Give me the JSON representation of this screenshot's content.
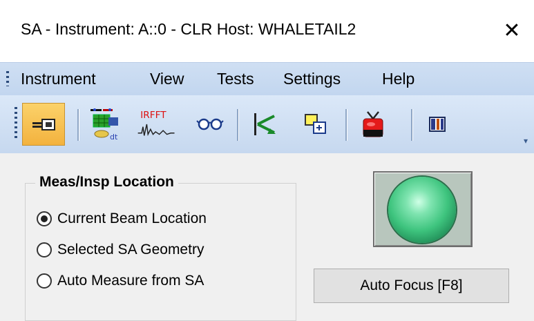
{
  "window": {
    "title": "SA - Instrument: A::0 - CLR Host: WHALETAIL2",
    "close_glyph": "✕"
  },
  "menu": {
    "items": [
      "Instrument",
      "View",
      "Tests",
      "Settings",
      "Help"
    ]
  },
  "toolbar": {
    "buttons": [
      {
        "icon": "connector-icon",
        "active": true
      },
      {
        "icon": "instrument-setup-icon",
        "active": false
      },
      {
        "icon": "irfft-icon",
        "label": "IRFFT",
        "active": false
      },
      {
        "icon": "glasses-icon",
        "active": false
      },
      {
        "icon": "beam-vector-icon",
        "active": false
      },
      {
        "icon": "window-overlap-icon",
        "active": false
      },
      {
        "icon": "tv-record-icon",
        "active": false
      },
      {
        "icon": "panel-layout-icon",
        "active": false
      }
    ]
  },
  "meas_location": {
    "title": "Meas/Insp Location",
    "options": [
      {
        "label": "Current Beam Location",
        "checked": true
      },
      {
        "label": "Selected SA Geometry",
        "checked": false
      },
      {
        "label": "Auto Measure from SA",
        "checked": false
      }
    ]
  },
  "status_lamp": {
    "color": "#3ec47e"
  },
  "auto_focus": {
    "label": "Auto Focus [F8]"
  }
}
